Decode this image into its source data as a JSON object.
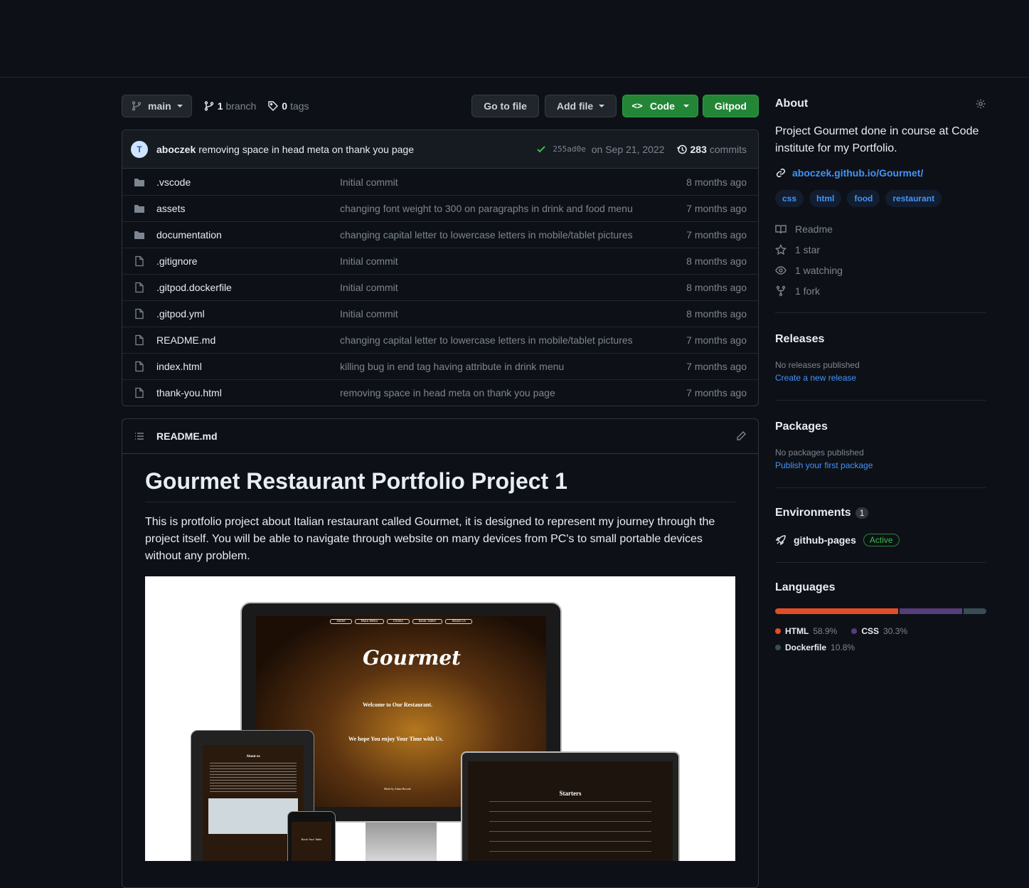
{
  "toolbar": {
    "branch": "main",
    "branches_count": "1",
    "branches_label": "branch",
    "tags_count": "0",
    "tags_label": "tags",
    "go_to_file": "Go to file",
    "add_file": "Add file",
    "code": "Code",
    "gitpod": "Gitpod"
  },
  "commit": {
    "author": "aboczek",
    "message": "removing space in head meta on thank you page",
    "sha": "255ad0e",
    "date": "on Sep 21, 2022",
    "count": "283",
    "count_label": "commits"
  },
  "files": [
    {
      "name": ".vscode",
      "type": "folder",
      "message": "Initial commit",
      "age": "8 months ago"
    },
    {
      "name": "assets",
      "type": "folder",
      "message": "changing font weight to 300 on paragraphs in drink and food menu",
      "age": "7 months ago"
    },
    {
      "name": "documentation",
      "type": "folder",
      "message": "changing capital letter to lowercase letters in mobile/tablet pictures",
      "age": "7 months ago"
    },
    {
      "name": ".gitignore",
      "type": "file",
      "message": "Initial commit",
      "age": "8 months ago"
    },
    {
      "name": ".gitpod.dockerfile",
      "type": "file",
      "message": "Initial commit",
      "age": "8 months ago"
    },
    {
      "name": ".gitpod.yml",
      "type": "file",
      "message": "Initial commit",
      "age": "8 months ago"
    },
    {
      "name": "README.md",
      "type": "file",
      "message": "changing capital letter to lowercase letters in mobile/tablet pictures",
      "age": "7 months ago"
    },
    {
      "name": "index.html",
      "type": "file",
      "message": "killing bug in end tag having attribute in drink menu",
      "age": "7 months ago"
    },
    {
      "name": "thank-you.html",
      "type": "file",
      "message": "removing space in head meta on thank you page",
      "age": "7 months ago"
    }
  ],
  "readme": {
    "filename": "README.md",
    "title": "Gourmet Restaurant Portfolio Project 1",
    "paragraph": "This is protfolio project about Italian restaurant called Gourmet, it is designed to represent my journey through the project itself. You will be able to navigate through website on many devices from PC's to small portable devices without any problem.",
    "mockup": {
      "nav": [
        "Home",
        "Main Menu",
        "Drinks",
        "Book Table!",
        "About Us"
      ],
      "logo": "Gourmet",
      "welcome": "Welcome to Our Restaurant.",
      "tagline": "We hope You enjoy Your Time with Us.",
      "credit": "Made by Adam Boczek",
      "menu_heading": "Starters",
      "tablet_heading": "About us",
      "phone_label": "Book Your Table"
    }
  },
  "about": {
    "heading": "About",
    "description": "Project Gourmet done in course at Code institute for my Portfolio.",
    "website": "aboczek.github.io/Gourmet/",
    "topics": [
      "css",
      "html",
      "food",
      "restaurant"
    ],
    "readme_label": "Readme",
    "stars": "1 star",
    "watching": "1 watching",
    "forks": "1 fork"
  },
  "releases": {
    "heading": "Releases",
    "empty": "No releases published",
    "link": "Create a new release"
  },
  "packages": {
    "heading": "Packages",
    "empty": "No packages published",
    "link": "Publish your first package"
  },
  "environments": {
    "heading": "Environments",
    "count": "1",
    "name": "github-pages",
    "status": "Active"
  },
  "languages": {
    "heading": "Languages",
    "items": [
      {
        "name": "HTML",
        "percent": "58.9%",
        "value": 58.9,
        "color": "#e34c26"
      },
      {
        "name": "CSS",
        "percent": "30.3%",
        "value": 30.3,
        "color": "#563d7c"
      },
      {
        "name": "Dockerfile",
        "percent": "10.8%",
        "value": 10.8,
        "color": "#384d54"
      }
    ]
  }
}
